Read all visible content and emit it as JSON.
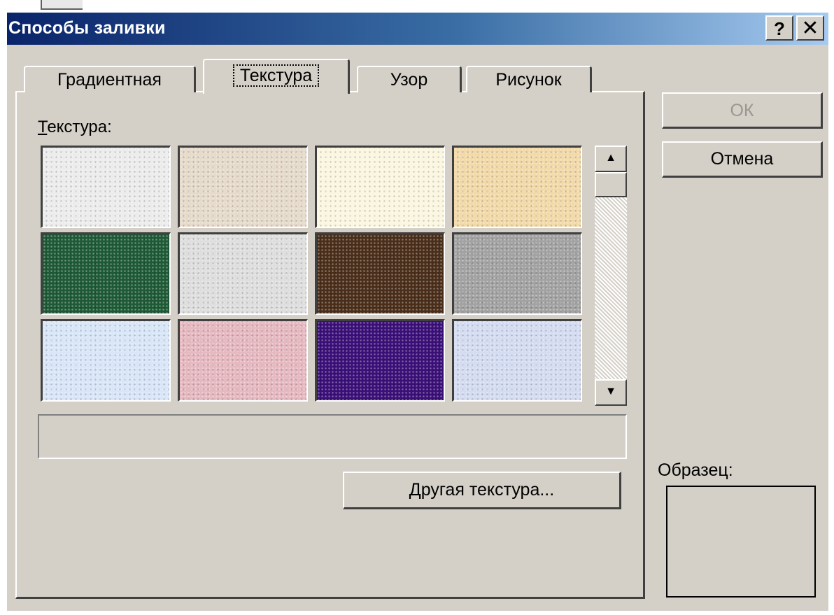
{
  "window": {
    "title": "Способы заливки",
    "help_label": "?",
    "close_label": "✕"
  },
  "tabs": [
    {
      "label": "Градиентная",
      "active": false
    },
    {
      "label": "Текстура",
      "active": true
    },
    {
      "label": "Узор",
      "active": false
    },
    {
      "label": "Рисунок",
      "active": false
    }
  ],
  "texture_section": {
    "label_first": "Т",
    "label_rest": "екстура:",
    "swatches": [
      {
        "name": "white-paper",
        "color": "#ececec"
      },
      {
        "name": "beige-sand",
        "color": "#e6dacb"
      },
      {
        "name": "cream-parchment",
        "color": "#fbf6e0"
      },
      {
        "name": "peach-granite",
        "color": "#f2d9a8"
      },
      {
        "name": "green-marble",
        "color": "#1e5a36"
      },
      {
        "name": "white-marble",
        "color": "#dedede"
      },
      {
        "name": "brown-marble",
        "color": "#4a2e1a"
      },
      {
        "name": "gray-granite",
        "color": "#a2a2a2"
      },
      {
        "name": "blue-tissue",
        "color": "#d8e6f8"
      },
      {
        "name": "pink-tissue",
        "color": "#e6b8c0"
      },
      {
        "name": "purple-mesh",
        "color": "#3a0f78"
      },
      {
        "name": "bouquet",
        "color": "#d4dcf2"
      }
    ],
    "texture_name": ""
  },
  "scrollbar": {
    "up_arrow": "▲",
    "down_arrow": "▼"
  },
  "buttons": {
    "other_texture_first": "Д",
    "other_texture_rest": "ругая текстура...",
    "ok": "ОК",
    "cancel": "Отмена"
  },
  "sample": {
    "label": "Образец:"
  }
}
